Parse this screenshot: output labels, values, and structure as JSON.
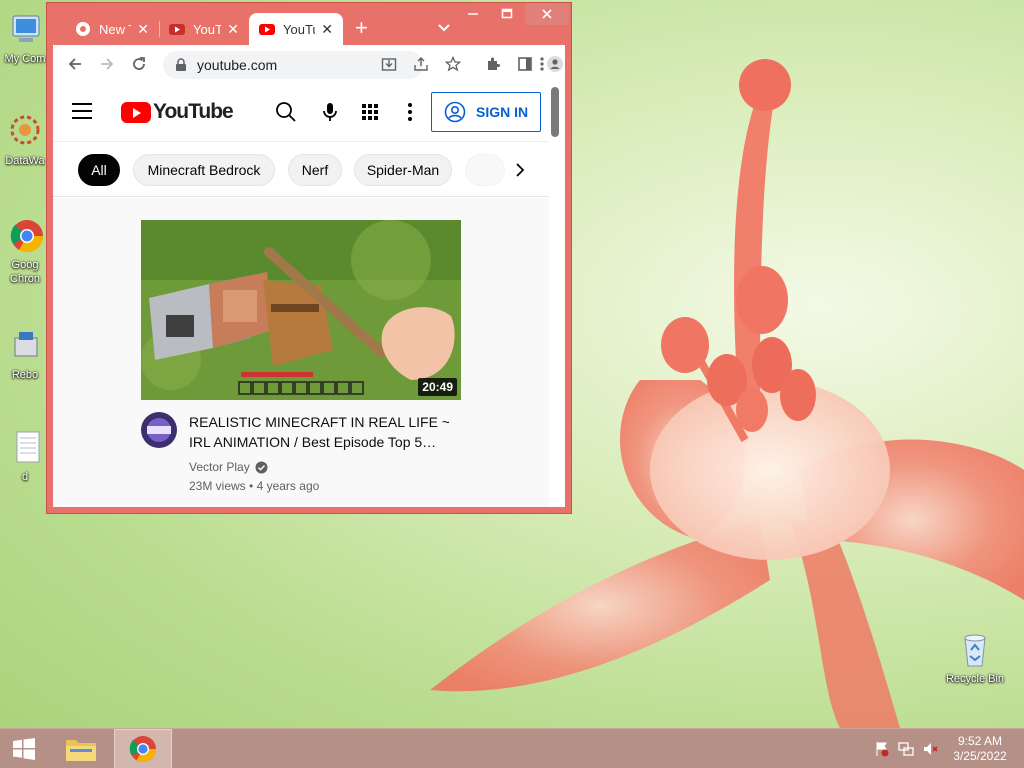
{
  "desktop": {
    "icons": [
      {
        "label": "My Com",
        "icon": "computer-icon"
      },
      {
        "label": "DataWa",
        "icon": "datawarp-icon"
      },
      {
        "label": "Goog",
        "label2": "Chron",
        "icon": "chrome-icon"
      },
      {
        "label": "Rebo",
        "icon": "reboot-icon"
      },
      {
        "label": "d",
        "icon": "document-icon"
      },
      {
        "label": "Recycle Bin",
        "icon": "recycle-bin-icon"
      }
    ]
  },
  "browser": {
    "tabs": [
      {
        "title": "New T",
        "icon": "chrome-favicon"
      },
      {
        "title": "YouTu",
        "icon": "youtube-favicon"
      },
      {
        "title": "YouTu",
        "icon": "youtube-favicon",
        "active": true
      }
    ],
    "address": "youtube.com"
  },
  "youtube": {
    "logo_text": "YouTube",
    "sign_in": "SIGN IN",
    "chips": [
      "All",
      "Minecraft Bedrock",
      "Nerf",
      "Spider-Man"
    ],
    "video": {
      "title_line1": "REALISTIC MINECRAFT IN REAL LIFE ~",
      "title_line2": "IRL ANIMATION / Best Episode Top 5…",
      "duration": "20:49",
      "channel": "Vector Play",
      "views": "23M views",
      "age": "4 years ago",
      "meta_separator": "•"
    }
  },
  "taskbar": {
    "time": "9:52 AM",
    "date": "3/25/2022"
  },
  "colors": {
    "window_frame": "#e8726a",
    "youtube_red": "#ff0000",
    "signin_blue": "#065fd4",
    "taskbar": "#b59086"
  }
}
